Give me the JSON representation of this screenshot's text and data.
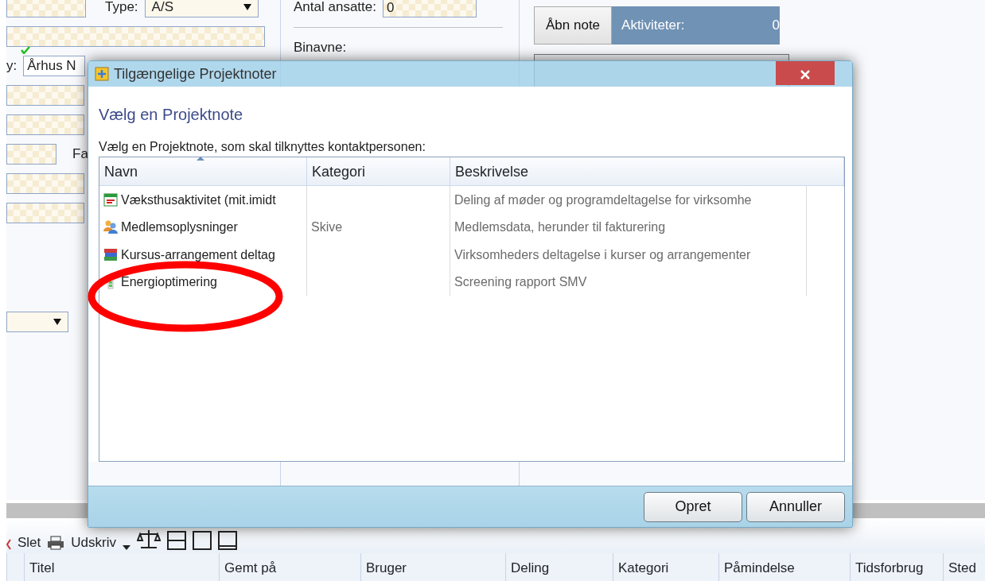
{
  "background": {
    "form": {
      "type_label": "Type:",
      "type_value": "A/S",
      "city_label": "y:",
      "city_value": "Århus N",
      "city_valid": true,
      "fax_label": "Fa",
      "employees_label": "Antal ansatte:",
      "employees_value": "0",
      "alt_names_label": "Binavne:"
    },
    "open_note_button": "Åbn note",
    "activities": {
      "label": "Aktiviteter:",
      "count": "0"
    },
    "toolbar": {
      "delete": "Slet",
      "print": "Udskriv"
    },
    "notes_table": {
      "columns": [
        "Titel",
        "Gemt på",
        "Bruger",
        "Deling",
        "Kategori",
        "Påmindelse",
        "Tidsforbrug",
        "Sted"
      ]
    }
  },
  "dialog": {
    "title": "Tilgængelige Projektnoter",
    "heading": "Vælg en Projektnote",
    "instruction": "Vælg en Projektnote, som skal tilknyttes kontaktpersonen:",
    "list": {
      "columns": [
        {
          "label": "Navn",
          "sorted": true
        },
        {
          "label": "Kategori",
          "sorted": false
        },
        {
          "label": "Beskrivelse",
          "sorted": false
        }
      ],
      "rows": [
        {
          "kind": "calendar",
          "name": "Væksthusaktivitet (mit.imidt",
          "description": "Deling af møder og programdeltagelse for virksomhe"
        },
        {
          "kind": "people",
          "name": "Medlemsoplysninger",
          "category": "Skive",
          "description": "Medlemsdata, herunder til fakturering"
        },
        {
          "kind": "books",
          "name": "Kursus-arrangement deltag",
          "description": "Virksomheders deltagelse i kurser og arrangementer"
        },
        {
          "kind": "battery",
          "name": "Energioptimering",
          "description": "Screening rapport SMV"
        }
      ]
    },
    "buttons": [
      "Opret",
      "Annuller"
    ]
  }
}
